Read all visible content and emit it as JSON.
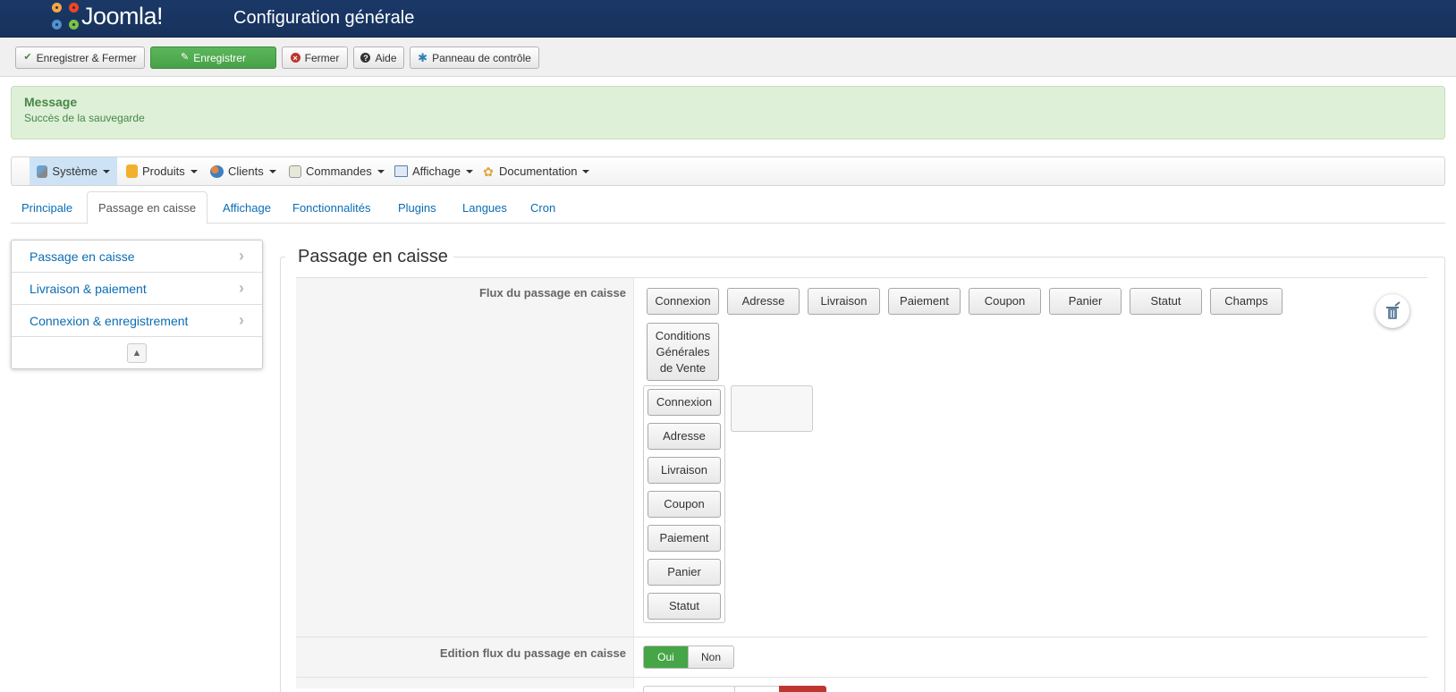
{
  "header": {
    "logo_text": "Joomla!",
    "title": "Configuration générale"
  },
  "toolbar": {
    "save_close": "Enregistrer & Fermer",
    "save": "Enregistrer",
    "close": "Fermer",
    "help": "Aide",
    "control_panel": "Panneau de contrôle"
  },
  "alert": {
    "heading": "Message",
    "body": "Succès de la sauvegarde"
  },
  "menu": {
    "items": [
      {
        "label": "Système",
        "icon": "tools-icon"
      },
      {
        "label": "Produits",
        "icon": "products-icon"
      },
      {
        "label": "Clients",
        "icon": "users-icon"
      },
      {
        "label": "Commandes",
        "icon": "orders-icon"
      },
      {
        "label": "Affichage",
        "icon": "display-icon"
      },
      {
        "label": "Documentation",
        "icon": "documentation-icon"
      }
    ]
  },
  "tabs": [
    {
      "label": "Principale"
    },
    {
      "label": "Passage en caisse"
    },
    {
      "label": "Affichage"
    },
    {
      "label": "Fonctionnalités"
    },
    {
      "label": "Plugins"
    },
    {
      "label": "Langues"
    },
    {
      "label": "Cron"
    }
  ],
  "sidenav": {
    "items": [
      {
        "label": "Passage en caisse"
      },
      {
        "label": "Livraison & paiement"
      },
      {
        "label": "Connexion & enregistrement"
      }
    ]
  },
  "section": {
    "legend": "Passage en caisse",
    "flow_label": "Flux du passage en caisse",
    "flow_top": [
      "Connexion",
      "Adresse",
      "Livraison",
      "Paiement",
      "Coupon",
      "Panier",
      "Statut",
      "Champs"
    ],
    "flow_cgv": "Conditions Générales de Vente",
    "flow_step": [
      "Connexion",
      "Adresse",
      "Livraison",
      "Coupon",
      "Paiement",
      "Panier",
      "Statut"
    ],
    "edit_label": "Edition flux du passage en caisse",
    "toggle_yes": "Oui",
    "toggle_no": "Non"
  },
  "colors": {
    "header_bg": "#17325c",
    "success_green": "#46a546",
    "link_blue": "#0a6cb4",
    "danger_red": "#bd362f"
  }
}
